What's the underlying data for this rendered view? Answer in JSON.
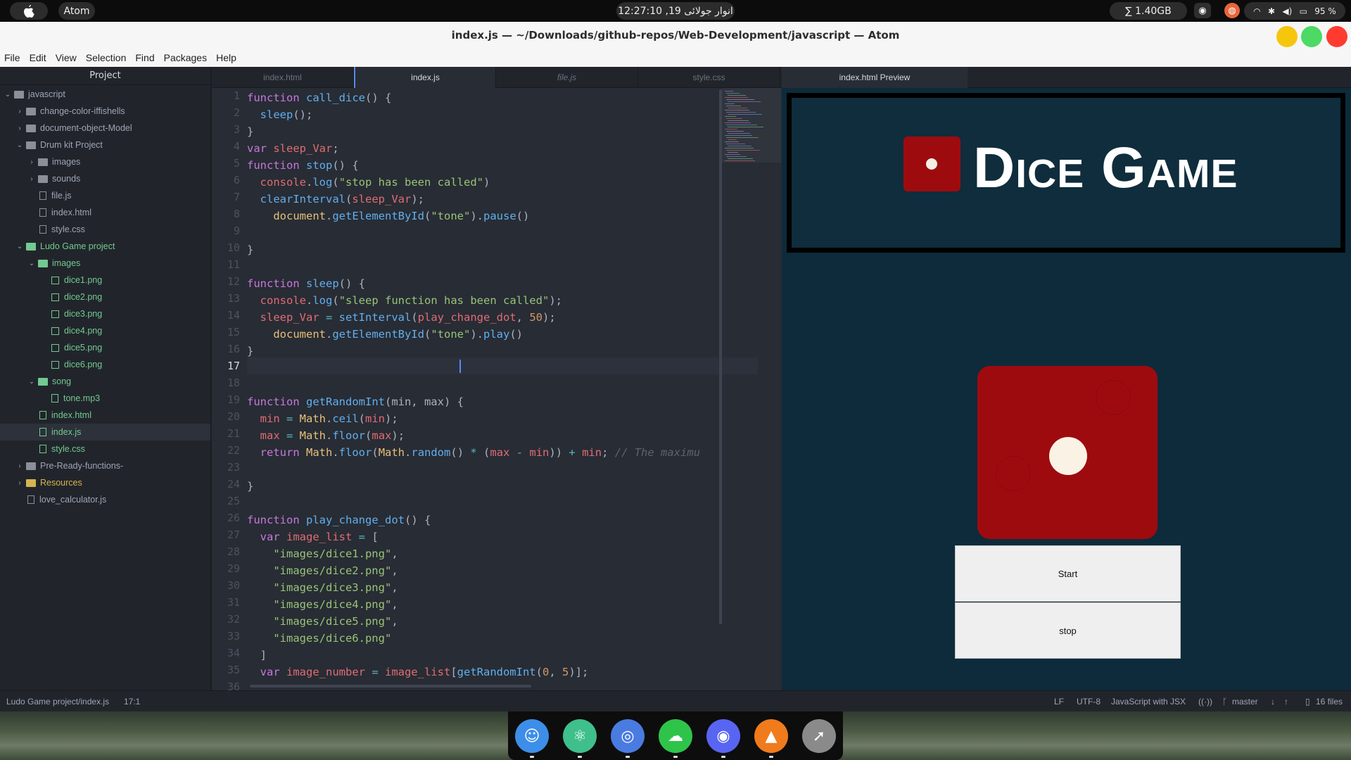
{
  "system_bar": {
    "app_name": "Atom",
    "clock": "انوار جولائی 19, 12:27:10",
    "memory": "∑ 1.40GB",
    "battery": "95 %"
  },
  "window": {
    "title": "index.js — ~/Downloads/github-repos/Web-Development/javascript — Atom"
  },
  "menu": [
    "File",
    "Edit",
    "View",
    "Selection",
    "Find",
    "Packages",
    "Help"
  ],
  "sidebar": {
    "header": "Project",
    "items": [
      {
        "label": "javascript",
        "type": "folder",
        "open": true,
        "depth": 0
      },
      {
        "label": "change-color-iffishells",
        "type": "folder",
        "open": false,
        "depth": 1
      },
      {
        "label": "document-object-Model",
        "type": "folder",
        "open": false,
        "depth": 1
      },
      {
        "label": "Drum kit Project",
        "type": "folder",
        "open": true,
        "depth": 1
      },
      {
        "label": "images",
        "type": "folder",
        "open": false,
        "depth": 2
      },
      {
        "label": "sounds",
        "type": "folder",
        "open": false,
        "depth": 2
      },
      {
        "label": "file.js",
        "type": "file",
        "depth": 2
      },
      {
        "label": "index.html",
        "type": "file",
        "depth": 2
      },
      {
        "label": "style.css",
        "type": "file",
        "depth": 2
      },
      {
        "label": "Ludo Game project",
        "type": "folder",
        "open": true,
        "depth": 1,
        "status": "green"
      },
      {
        "label": "images",
        "type": "folder",
        "open": true,
        "depth": 2,
        "status": "green"
      },
      {
        "label": "dice1.png",
        "type": "image",
        "depth": 3,
        "status": "green"
      },
      {
        "label": "dice2.png",
        "type": "image",
        "depth": 3,
        "status": "green"
      },
      {
        "label": "dice3.png",
        "type": "image",
        "depth": 3,
        "status": "green"
      },
      {
        "label": "dice4.png",
        "type": "image",
        "depth": 3,
        "status": "green"
      },
      {
        "label": "dice5.png",
        "type": "image",
        "depth": 3,
        "status": "green"
      },
      {
        "label": "dice6.png",
        "type": "image",
        "depth": 3,
        "status": "green"
      },
      {
        "label": "song",
        "type": "folder",
        "open": true,
        "depth": 2,
        "status": "green"
      },
      {
        "label": "tone.mp3",
        "type": "file",
        "depth": 3,
        "status": "green"
      },
      {
        "label": "index.html",
        "type": "file",
        "depth": 2,
        "status": "green"
      },
      {
        "label": "index.js",
        "type": "file",
        "depth": 2,
        "status": "green",
        "selected": true
      },
      {
        "label": "style.css",
        "type": "file",
        "depth": 2,
        "status": "green"
      },
      {
        "label": "Pre-Ready-functions-",
        "type": "folder",
        "open": false,
        "depth": 1
      },
      {
        "label": "Resources",
        "type": "folder",
        "open": false,
        "depth": 1,
        "status": "yellow"
      },
      {
        "label": "love_calculator.js",
        "type": "file",
        "depth": 1
      }
    ]
  },
  "editor": {
    "tabs": [
      {
        "label": "index.html",
        "active": false,
        "italic": false
      },
      {
        "label": "index.js",
        "active": true,
        "italic": false
      },
      {
        "label": "file.js",
        "active": false,
        "italic": true
      },
      {
        "label": "style.css",
        "active": false,
        "italic": false
      }
    ],
    "current_line": 17,
    "lines": [
      [
        [
          "k",
          "function "
        ],
        [
          "f",
          "call_dice"
        ],
        [
          "p",
          "() {"
        ]
      ],
      [
        [
          "p",
          "  "
        ],
        [
          "f",
          "sleep"
        ],
        [
          "p",
          "();"
        ]
      ],
      [
        [
          "p",
          "}"
        ]
      ],
      [
        [
          "k",
          "var "
        ],
        [
          "v",
          "sleep_Var"
        ],
        [
          "p",
          ";"
        ]
      ],
      [
        [
          "k",
          "function "
        ],
        [
          "f",
          "stop"
        ],
        [
          "p",
          "() {"
        ]
      ],
      [
        [
          "p",
          "  "
        ],
        [
          "v",
          "console"
        ],
        [
          "p",
          "."
        ],
        [
          "f",
          "log"
        ],
        [
          "p",
          "("
        ],
        [
          "s",
          "\"stop has been called\""
        ],
        [
          "p",
          ")"
        ]
      ],
      [
        [
          "p",
          "  "
        ],
        [
          "f",
          "clearInterval"
        ],
        [
          "p",
          "("
        ],
        [
          "v",
          "sleep_Var"
        ],
        [
          "p",
          ");"
        ]
      ],
      [
        [
          "p",
          "    "
        ],
        [
          "y",
          "document"
        ],
        [
          "p",
          "."
        ],
        [
          "f",
          "getElementById"
        ],
        [
          "p",
          "("
        ],
        [
          "s",
          "\"tone\""
        ],
        [
          "p",
          ")."
        ],
        [
          "f",
          "pause"
        ],
        [
          "p",
          "()"
        ]
      ],
      [
        [
          "p",
          ""
        ]
      ],
      [
        [
          "p",
          "}"
        ]
      ],
      [
        [
          "p",
          ""
        ]
      ],
      [
        [
          "k",
          "function "
        ],
        [
          "f",
          "sleep"
        ],
        [
          "p",
          "() {"
        ]
      ],
      [
        [
          "p",
          "  "
        ],
        [
          "v",
          "console"
        ],
        [
          "p",
          "."
        ],
        [
          "f",
          "log"
        ],
        [
          "p",
          "("
        ],
        [
          "s",
          "\"sleep function has been called\""
        ],
        [
          "p",
          ");"
        ]
      ],
      [
        [
          "p",
          "  "
        ],
        [
          "v",
          "sleep_Var"
        ],
        [
          "o",
          " = "
        ],
        [
          "f",
          "setInterval"
        ],
        [
          "p",
          "("
        ],
        [
          "v",
          "play_change_dot"
        ],
        [
          "p",
          ", "
        ],
        [
          "n",
          "50"
        ],
        [
          "p",
          ");"
        ]
      ],
      [
        [
          "p",
          "    "
        ],
        [
          "y",
          "document"
        ],
        [
          "p",
          "."
        ],
        [
          "f",
          "getElementById"
        ],
        [
          "p",
          "("
        ],
        [
          "s",
          "\"tone\""
        ],
        [
          "p",
          ")."
        ],
        [
          "f",
          "play"
        ],
        [
          "p",
          "()"
        ]
      ],
      [
        [
          "p",
          "}"
        ]
      ],
      [
        [
          "p",
          ""
        ]
      ],
      [
        [
          "p",
          ""
        ]
      ],
      [
        [
          "k",
          "function "
        ],
        [
          "f",
          "getRandomInt"
        ],
        [
          "p",
          "(min, max) {"
        ]
      ],
      [
        [
          "p",
          "  "
        ],
        [
          "v",
          "min"
        ],
        [
          "o",
          " = "
        ],
        [
          "y",
          "Math"
        ],
        [
          "p",
          "."
        ],
        [
          "f",
          "ceil"
        ],
        [
          "p",
          "("
        ],
        [
          "v",
          "min"
        ],
        [
          "p",
          ");"
        ]
      ],
      [
        [
          "p",
          "  "
        ],
        [
          "v",
          "max"
        ],
        [
          "o",
          " = "
        ],
        [
          "y",
          "Math"
        ],
        [
          "p",
          "."
        ],
        [
          "f",
          "floor"
        ],
        [
          "p",
          "("
        ],
        [
          "v",
          "max"
        ],
        [
          "p",
          ");"
        ]
      ],
      [
        [
          "p",
          "  "
        ],
        [
          "k",
          "return "
        ],
        [
          "y",
          "Math"
        ],
        [
          "p",
          "."
        ],
        [
          "f",
          "floor"
        ],
        [
          "p",
          "("
        ],
        [
          "y",
          "Math"
        ],
        [
          "p",
          "."
        ],
        [
          "f",
          "random"
        ],
        [
          "p",
          "() "
        ],
        [
          "o",
          "*"
        ],
        [
          "p",
          " ("
        ],
        [
          "v",
          "max"
        ],
        [
          "o",
          " - "
        ],
        [
          "v",
          "min"
        ],
        [
          "p",
          ")) "
        ],
        [
          "o",
          "+"
        ],
        [
          "p",
          " "
        ],
        [
          "v",
          "min"
        ],
        [
          "p",
          "; "
        ],
        [
          "c",
          "// The maximu"
        ]
      ],
      [
        [
          "p",
          ""
        ]
      ],
      [
        [
          "p",
          "}"
        ]
      ],
      [
        [
          "p",
          ""
        ]
      ],
      [
        [
          "k",
          "function "
        ],
        [
          "f",
          "play_change_dot"
        ],
        [
          "p",
          "() {"
        ]
      ],
      [
        [
          "p",
          "  "
        ],
        [
          "k",
          "var "
        ],
        [
          "v",
          "image_list"
        ],
        [
          "o",
          " = "
        ],
        [
          "p",
          "["
        ]
      ],
      [
        [
          "p",
          "    "
        ],
        [
          "s",
          "\"images/dice1.png\""
        ],
        [
          "p",
          ","
        ]
      ],
      [
        [
          "p",
          "    "
        ],
        [
          "s",
          "\"images/dice2.png\""
        ],
        [
          "p",
          ","
        ]
      ],
      [
        [
          "p",
          "    "
        ],
        [
          "s",
          "\"images/dice3.png\""
        ],
        [
          "p",
          ","
        ]
      ],
      [
        [
          "p",
          "    "
        ],
        [
          "s",
          "\"images/dice4.png\""
        ],
        [
          "p",
          ","
        ]
      ],
      [
        [
          "p",
          "    "
        ],
        [
          "s",
          "\"images/dice5.png\""
        ],
        [
          "p",
          ","
        ]
      ],
      [
        [
          "p",
          "    "
        ],
        [
          "s",
          "\"images/dice6.png\""
        ]
      ],
      [
        [
          "p",
          "  ]"
        ]
      ],
      [
        [
          "p",
          "  "
        ],
        [
          "k",
          "var "
        ],
        [
          "v",
          "image_number"
        ],
        [
          "o",
          " = "
        ],
        [
          "v",
          "image_list"
        ],
        [
          "p",
          "["
        ],
        [
          "f",
          "getRandomInt"
        ],
        [
          "p",
          "("
        ],
        [
          "n",
          "0"
        ],
        [
          "p",
          ", "
        ],
        [
          "n",
          "5"
        ],
        [
          "p",
          ")];"
        ]
      ]
    ],
    "partial_last_line": "36"
  },
  "preview": {
    "tab_label": "index.html Preview",
    "title": "Dice Game",
    "start_label": "Start",
    "stop_label": "stop",
    "dice_color": "#9e0b0f",
    "background": "#0e2b3b"
  },
  "status_bar": {
    "path": "Ludo Game project/index.js",
    "cursor": "17:1",
    "line_ending": "LF",
    "encoding": "UTF-8",
    "grammar": "JavaScript with JSX",
    "branch": "master",
    "files": "16 files"
  },
  "dock": {
    "apps": [
      {
        "name": "finder-icon",
        "color": "#3d8ee8"
      },
      {
        "name": "atom-icon",
        "color": "#3fbf8c"
      },
      {
        "name": "chromium-icon",
        "color": "#4a7be0"
      },
      {
        "name": "cloud-icon",
        "color": "#2ec44a"
      },
      {
        "name": "discord-icon",
        "color": "#5865f2"
      },
      {
        "name": "vlc-icon",
        "color": "#f07b1d"
      },
      {
        "name": "launchpad-icon",
        "color": "#8a8a8a"
      }
    ]
  }
}
